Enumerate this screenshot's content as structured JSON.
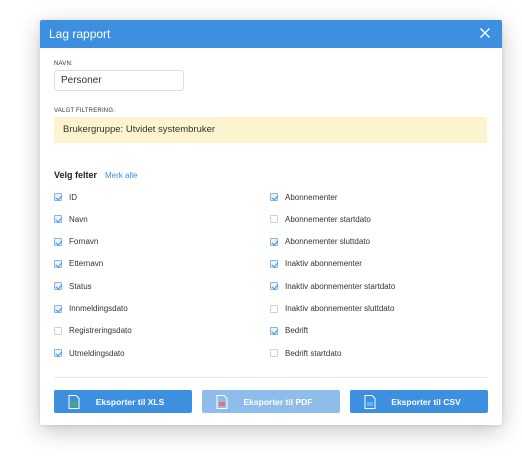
{
  "dialog": {
    "title": "Lag rapport"
  },
  "name_field": {
    "label": "NAVN:",
    "value": "Personer"
  },
  "filter": {
    "label": "VALGT FILTRERING:",
    "text": "Brukergruppe: Utvidet systembruker"
  },
  "fields": {
    "title": "Velg felter",
    "select_all": "Merk alle",
    "left": [
      {
        "label": "ID",
        "checked": true
      },
      {
        "label": "Navn",
        "checked": true
      },
      {
        "label": "Fornavn",
        "checked": true
      },
      {
        "label": "Etternavn",
        "checked": true
      },
      {
        "label": "Status",
        "checked": true
      },
      {
        "label": "Innmeldingsdato",
        "checked": true
      },
      {
        "label": "Registreringsdato",
        "checked": false
      },
      {
        "label": "Utmeldingsdato",
        "checked": true
      }
    ],
    "right": [
      {
        "label": "Abonnementer",
        "checked": true
      },
      {
        "label": "Abonnementer startdato",
        "checked": false
      },
      {
        "label": "Abonnementer sluttdato",
        "checked": true
      },
      {
        "label": "Inaktiv abonnementer",
        "checked": true
      },
      {
        "label": "Inaktiv abonnementer startdato",
        "checked": true
      },
      {
        "label": "Inaktiv abonnementer sluttdato",
        "checked": false
      },
      {
        "label": "Bedrift",
        "checked": true
      },
      {
        "label": "Bedrift startdato",
        "checked": false
      }
    ]
  },
  "buttons": {
    "xls": {
      "label": "Eksporter til XLS",
      "icon": "xls-file-icon"
    },
    "pdf": {
      "label": "Eksporter til PDF",
      "icon": "pdf-file-icon",
      "disabled": true
    },
    "csv": {
      "label": "Eksporter til CSV",
      "icon": "csv-file-icon"
    }
  },
  "colors": {
    "accent": "#3d8fe0",
    "accent_disabled": "#8fbdeb",
    "filter_background": "#fdf3cf"
  }
}
